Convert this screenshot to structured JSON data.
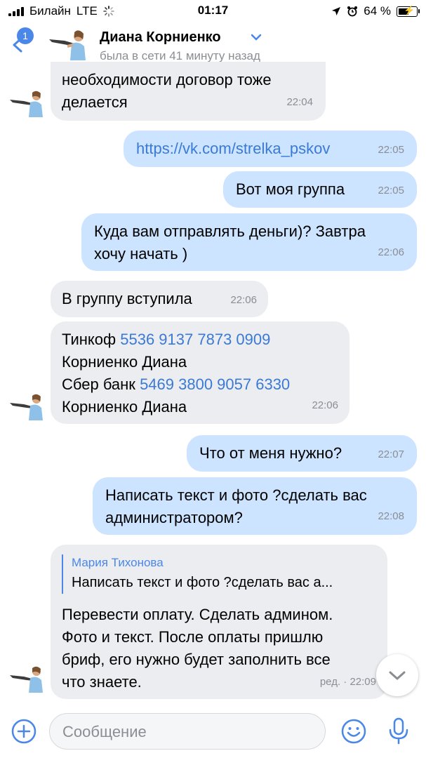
{
  "status_bar": {
    "carrier": "Билайн",
    "network": "LTE",
    "time": "01:17",
    "battery": "64 %",
    "battery_level": 0.64
  },
  "header": {
    "back_badge": "1",
    "contact_name": "Диана Корниенко",
    "contact_status": "была в сети 41 минуту назад"
  },
  "messages": [
    {
      "dir": "in",
      "lines": [
        "необходимости договор тоже",
        "делается"
      ],
      "time": "22:04"
    },
    {
      "dir": "out",
      "link": "https://vk.com/strelka_pskov",
      "time": "22:05"
    },
    {
      "dir": "out",
      "text": "Вот моя группа",
      "time": "22:05"
    },
    {
      "dir": "out",
      "lines": [
        "Куда вам отправлять деньги)? Завтра",
        "хочу начать )"
      ],
      "time": "22:06"
    },
    {
      "dir": "in",
      "text": "В группу вступила",
      "time": "22:06"
    },
    {
      "dir": "in",
      "bank1_label": "Тинкоф",
      "bank1_card": "5536 9137 7873 0909",
      "name1": "Корниенко Диана",
      "bank2_label": "Сбер банк",
      "bank2_card": "5469 3800 9057 6330",
      "name2": "Корниенко Диана",
      "time": "22:06"
    },
    {
      "dir": "out",
      "text": "Что от меня нужно?",
      "time": "22:07"
    },
    {
      "dir": "out",
      "lines": [
        "Написать текст и фото ?сделать вас",
        "администратором?"
      ],
      "time": "22:08"
    },
    {
      "dir": "in",
      "reply_author": "Мария Тихонова",
      "reply_text": "Написать текст и фото ?сделать вас а...",
      "lines": [
        "Перевести оплату. Сделать админом.",
        "Фото и текст. После оплаты пришлю",
        "бриф, его нужно будет заполнить все",
        "что знаете."
      ],
      "edited": "ред. ·",
      "time": "22:09"
    }
  ],
  "composer": {
    "placeholder": "Сообщение"
  },
  "colors": {
    "accent": "#4a87e8",
    "incoming_bubble": "#ebedf0",
    "outgoing_bubble": "#cce4ff",
    "link": "#3a7ad6"
  },
  "icons": [
    "signal-icon",
    "loading-icon",
    "location-icon",
    "alarm-icon",
    "battery-icon",
    "back-icon",
    "chevron-down-icon",
    "add-icon",
    "emoji-icon",
    "microphone-icon"
  ]
}
